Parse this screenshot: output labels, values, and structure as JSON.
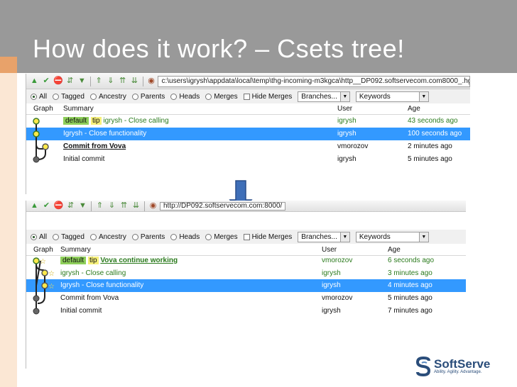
{
  "slide": {
    "title": "How does it work? – Csets tree!",
    "colors": {
      "title_bar": "#999999",
      "accent": "#e8a26a",
      "selection": "#3399ff",
      "arrow": "#3f6fb8"
    }
  },
  "toolbar_icons": [
    "arrow-up-icon",
    "check-icon",
    "stop-icon",
    "merge-icon",
    "push-up-icon",
    "pull-icon",
    "incoming-icon",
    "outgoing-icon",
    "repo-icon"
  ],
  "shot1": {
    "path": "c:\\users\\igrysh\\appdata\\local\\temp\\thg-incoming-m3kgca\\http__DP092.softservecom.com8000_.hg",
    "filters": {
      "all": "All",
      "tagged": "Tagged",
      "ancestry": "Ancestry",
      "parents": "Parents",
      "heads": "Heads",
      "merges": "Merges",
      "hide_merges": "Hide Merges",
      "branches": "Branches...",
      "keywords": "Keywords"
    },
    "columns": {
      "graph": "Graph",
      "summary": "Summary",
      "user": "User",
      "age": "Age"
    },
    "rows": [
      {
        "tag_default": "default",
        "tag_tip": "tip",
        "summary": "igrysh - Close calling",
        "user": "igrysh",
        "age": "43 seconds ago"
      },
      {
        "summary": "Igrysh - Close functionality",
        "user": "igrysh",
        "age": "100 seconds ago"
      },
      {
        "summary": "Commit from Vova",
        "user": "vmorozov",
        "age": "2 minutes ago"
      },
      {
        "summary": "Initial commit",
        "user": "igrysh",
        "age": "5 minutes ago"
      }
    ]
  },
  "shot2": {
    "path": "http://DP092.softservecom.com:8000/",
    "filters": {
      "all": "All",
      "tagged": "Tagged",
      "ancestry": "Ancestry",
      "parents": "Parents",
      "heads": "Heads",
      "merges": "Merges",
      "hide_merges": "Hide Merges",
      "branches": "Branches...",
      "keywords": "Keywords"
    },
    "columns": {
      "graph": "Graph",
      "summary": "Summary",
      "user": "User",
      "age": "Age"
    },
    "rows": [
      {
        "tag_default": "default",
        "tag_tip": "tip",
        "summary": "Vova continue working",
        "user": "vmorozov",
        "age": "6 seconds ago"
      },
      {
        "summary": "igrysh - Close calling",
        "user": "igrysh",
        "age": "3 minutes ago"
      },
      {
        "summary": "Igrysh - Close functionality",
        "user": "igrysh",
        "age": "4 minutes ago"
      },
      {
        "summary": "Commit from Vova",
        "user": "vmorozov",
        "age": "5 minutes ago"
      },
      {
        "summary": "Initial commit",
        "user": "igrysh",
        "age": "7 minutes ago"
      }
    ]
  },
  "logo": {
    "name": "SoftServe",
    "tagline": "Ability. Agility. Advantage."
  }
}
